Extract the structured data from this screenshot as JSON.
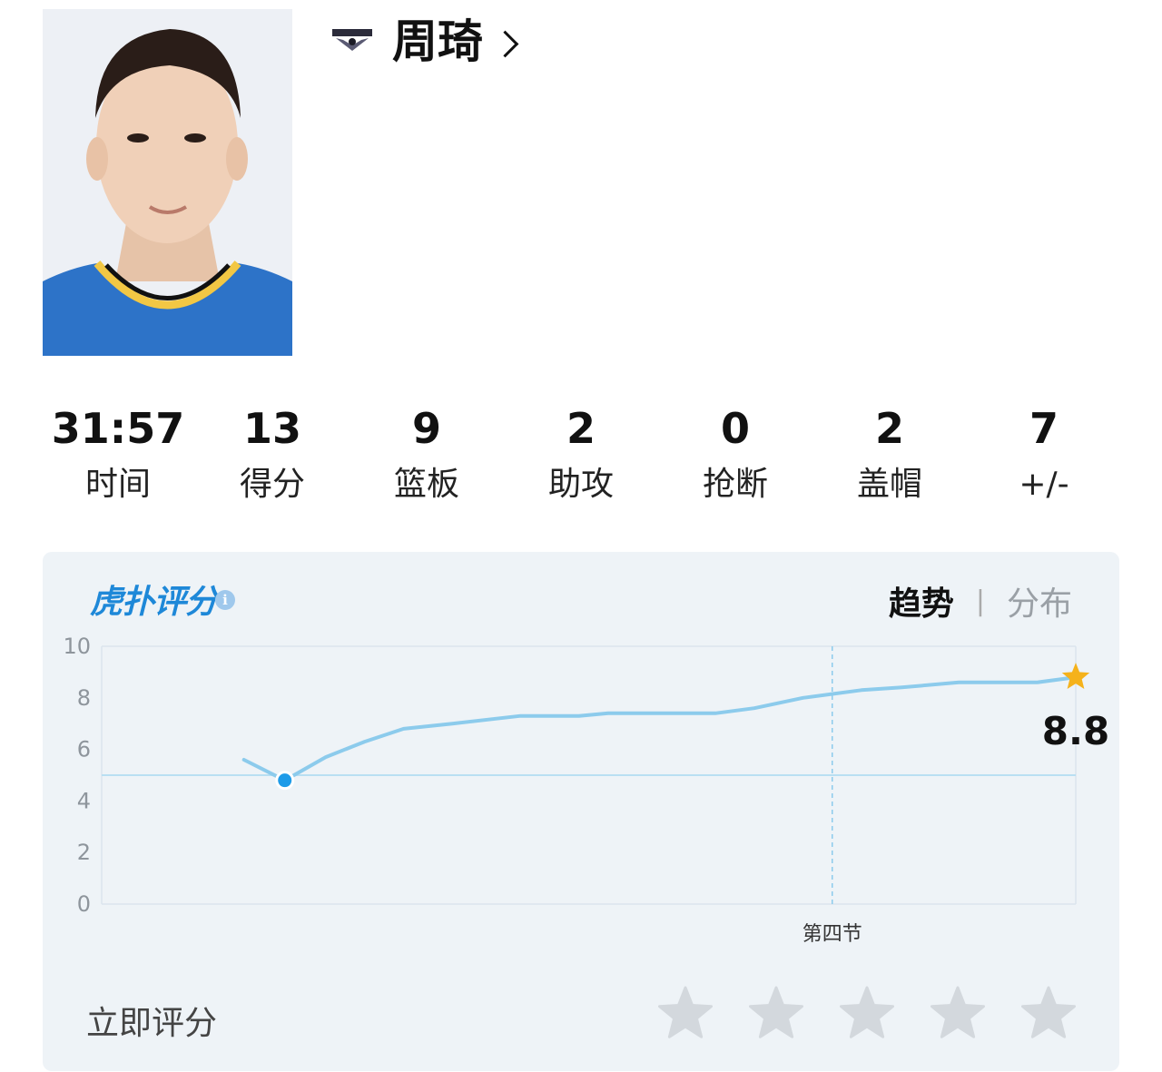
{
  "player": {
    "name": "周琦",
    "team_logo": "team-logo",
    "photo": "player-photo"
  },
  "stats": [
    {
      "value": "31:57",
      "label": "时间"
    },
    {
      "value": "13",
      "label": "得分"
    },
    {
      "value": "9",
      "label": "篮板"
    },
    {
      "value": "2",
      "label": "助攻"
    },
    {
      "value": "0",
      "label": "抢断"
    },
    {
      "value": "2",
      "label": "盖帽"
    },
    {
      "value": "7",
      "label": "+/-"
    }
  ],
  "rating": {
    "brand": "虎扑评分",
    "brand_mark": "®",
    "tabs": {
      "active": "趋势",
      "separator": "|",
      "inactive": "分布"
    },
    "rate_now": "立即评分",
    "star_count": 5
  },
  "chart_data": {
    "type": "line",
    "ylim": [
      0,
      10
    ],
    "yticks": [
      "0",
      "2",
      "4",
      "6",
      "8",
      "10"
    ],
    "reference_line": 5,
    "quarter_marker": {
      "label": "第四节",
      "position": 0.75
    },
    "points": [
      [
        0.146,
        5.6
      ],
      [
        0.188,
        4.8
      ],
      [
        0.23,
        5.7
      ],
      [
        0.27,
        6.3
      ],
      [
        0.31,
        6.8
      ],
      [
        0.36,
        7.0
      ],
      [
        0.43,
        7.3
      ],
      [
        0.49,
        7.3
      ],
      [
        0.52,
        7.4
      ],
      [
        0.58,
        7.4
      ],
      [
        0.63,
        7.4
      ],
      [
        0.67,
        7.6
      ],
      [
        0.72,
        8.0
      ],
      [
        0.78,
        8.3
      ],
      [
        0.82,
        8.4
      ],
      [
        0.88,
        8.6
      ],
      [
        0.96,
        8.6
      ],
      [
        1.0,
        8.8
      ]
    ],
    "low_point": [
      0.188,
      4.8
    ],
    "final_value": "8.8",
    "line_color": "#8ccbec",
    "marker_color": "#1e9be8",
    "star_color": "#f5b21b"
  }
}
